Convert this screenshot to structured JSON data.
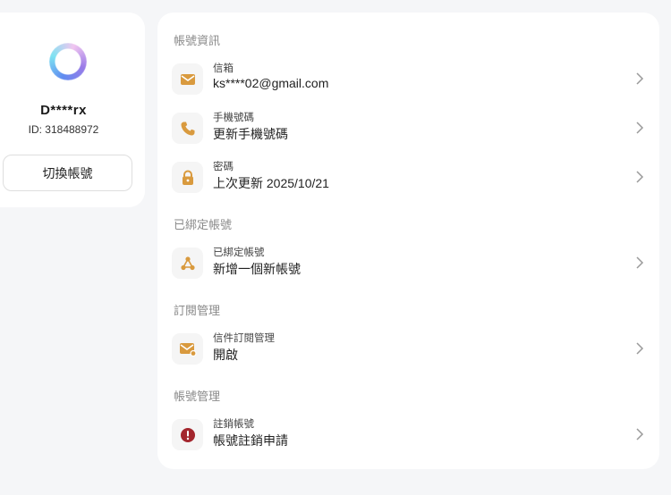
{
  "profile": {
    "username": "D****rx",
    "user_id": "ID: 318488972",
    "switch_label": "切換帳號"
  },
  "sections": {
    "account_info": {
      "title": "帳號資訊",
      "email": {
        "label": "信箱",
        "value": "ks****02@gmail.com",
        "icon": "envelope-icon"
      },
      "phone": {
        "label": "手機號碼",
        "value": "更新手機號碼",
        "icon": "phone-icon"
      },
      "password": {
        "label": "密碼",
        "value": "上次更新 2025/10/21",
        "icon": "lock-icon"
      }
    },
    "linked": {
      "title": "已綁定帳號",
      "linked_accounts": {
        "label": "已綁定帳號",
        "value": "新增一個新帳號",
        "icon": "share-nodes-icon"
      }
    },
    "subscription": {
      "title": "訂閱管理",
      "mail_subscription": {
        "label": "信件訂閱管理",
        "value": "開啟",
        "icon": "mail-settings-icon"
      }
    },
    "management": {
      "title": "帳號管理",
      "delete_account": {
        "label": "註銷帳號",
        "value": "帳號註銷申請",
        "icon": "alert-circle-icon"
      }
    }
  },
  "colors": {
    "accent": "#d99a3e",
    "danger": "#a3262d",
    "background": "#f5f6f8",
    "card": "#ffffff"
  }
}
